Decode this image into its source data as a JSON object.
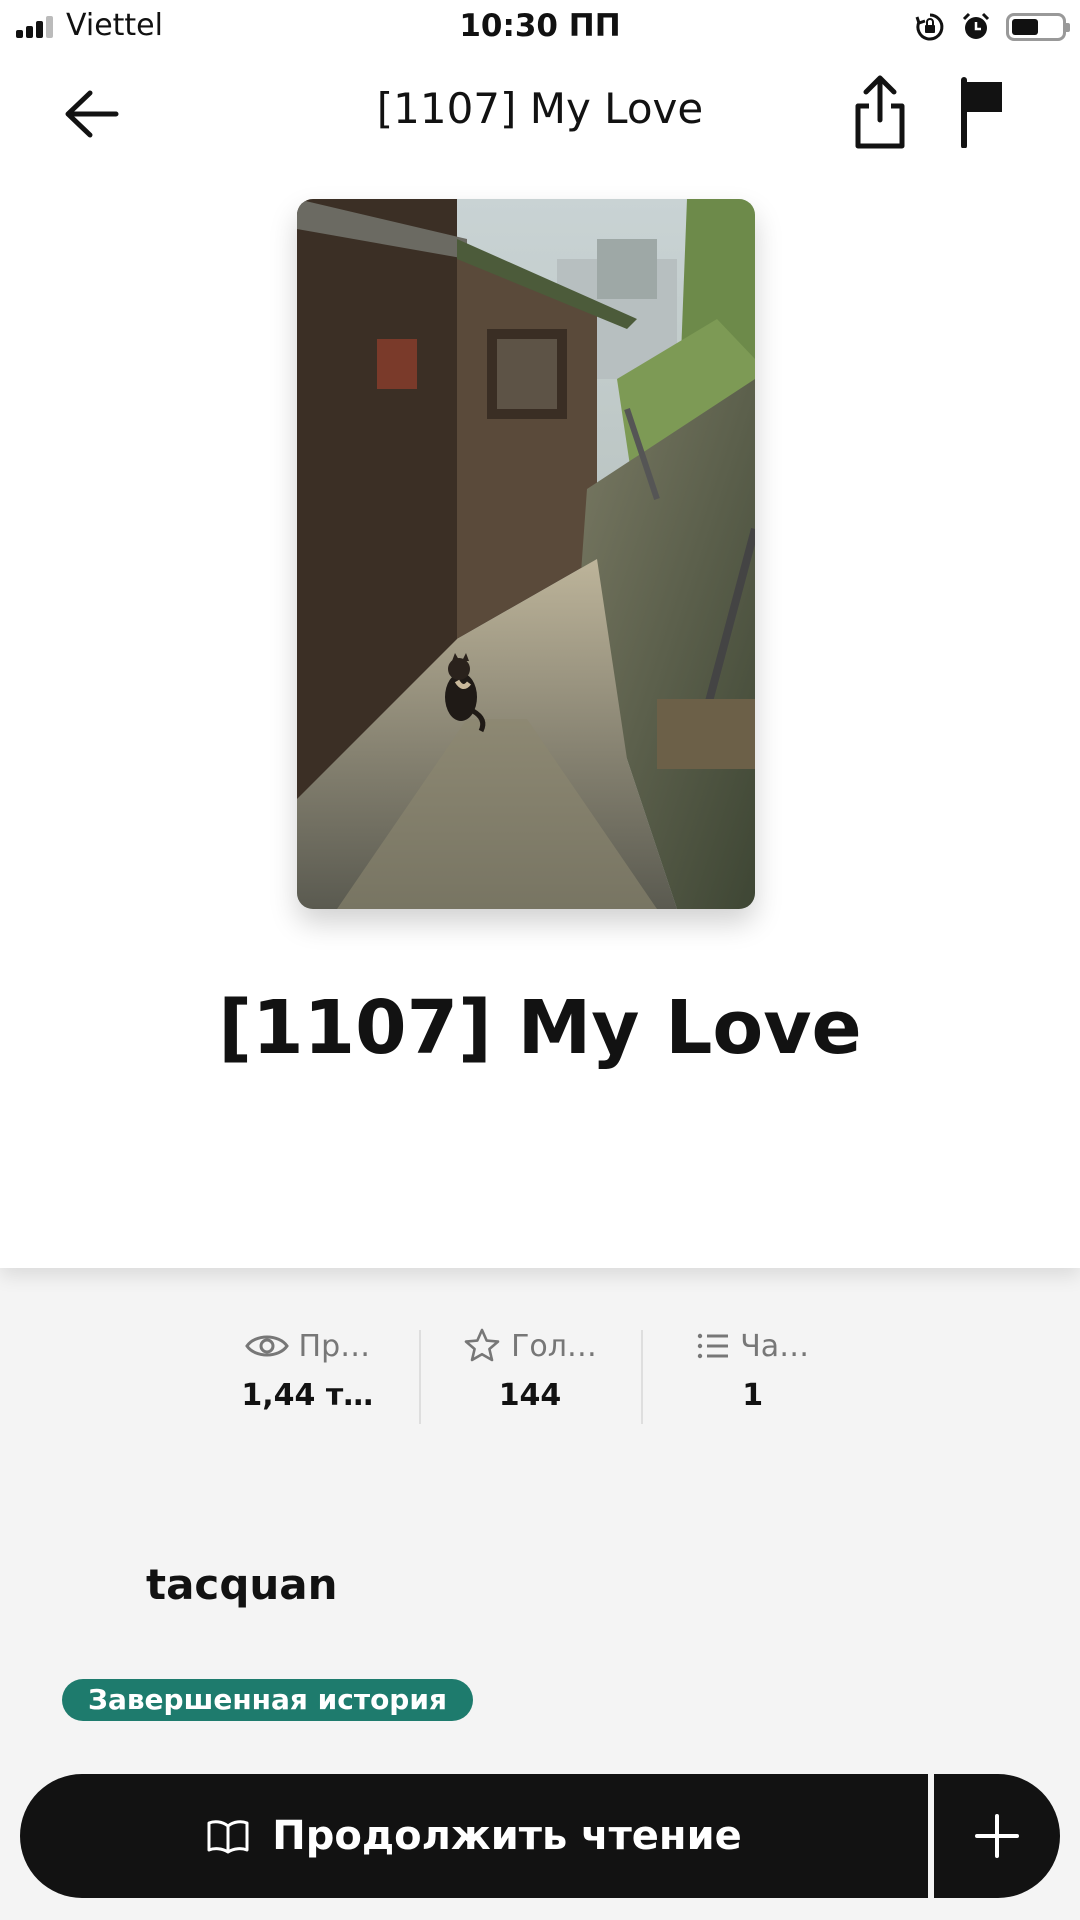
{
  "status_bar": {
    "carrier": "Viettel",
    "time": "10:30 ПП",
    "battery_level": 0.55
  },
  "nav": {
    "title": "[1107] My Love"
  },
  "story": {
    "title": "[1107] My Love",
    "author": "tacquan",
    "status_badge": "Завершенная история"
  },
  "stats": [
    {
      "icon": "eye-icon",
      "label": "Пр…",
      "value": "1,44 т…"
    },
    {
      "icon": "star-icon",
      "label": "Гол…",
      "value": "144"
    },
    {
      "icon": "list-icon",
      "label": "Ча…",
      "value": "1"
    }
  ],
  "actions": {
    "continue_label": "Продолжить чтение"
  },
  "colors": {
    "badge": "#1e7b6d",
    "button": "#121212",
    "page_bg": "#f4f4f4"
  }
}
